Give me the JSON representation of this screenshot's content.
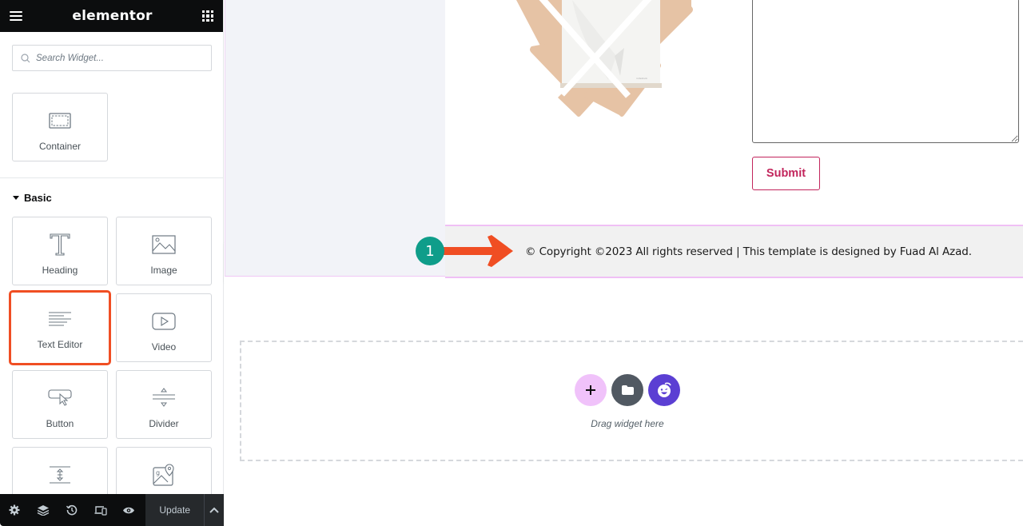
{
  "sidebar": {
    "brand": "elementor",
    "search": {
      "placeholder": "Search Widget...",
      "value": ""
    },
    "layout_widgets": [
      {
        "label": "Container",
        "icon": "container-icon"
      }
    ],
    "categories": [
      {
        "title": "Basic",
        "expanded": true,
        "widgets": [
          {
            "label": "Heading",
            "icon": "heading-icon",
            "highlighted": false
          },
          {
            "label": "Image",
            "icon": "image-icon",
            "highlighted": false
          },
          {
            "label": "Text Editor",
            "icon": "text-editor-icon",
            "highlighted": true
          },
          {
            "label": "Video",
            "icon": "video-icon",
            "highlighted": false
          },
          {
            "label": "Button",
            "icon": "button-icon",
            "highlighted": false
          },
          {
            "label": "Divider",
            "icon": "divider-icon",
            "highlighted": false
          },
          {
            "label": "",
            "icon": "spacer-icon",
            "highlighted": false
          },
          {
            "label": "",
            "icon": "google-maps-icon",
            "highlighted": false
          }
        ]
      }
    ],
    "bottom_bar": {
      "icons": [
        "settings-icon",
        "navigator-layers-icon",
        "history-icon",
        "responsive-mode-icon",
        "preview-eye-icon"
      ],
      "update_label": "Update"
    }
  },
  "canvas": {
    "form": {
      "submit_label": "Submit",
      "message_value": ""
    },
    "footer": {
      "text": "© Copyright ©2023 All rights reserved | This template is designed by Fuad Al Azad."
    },
    "annotation": {
      "number": "1",
      "color": "#0f9d8a",
      "arrow_color": "#f04e23"
    },
    "drop_zone": {
      "text": "Drag widget here",
      "buttons": [
        "add-section",
        "add-template",
        "ai-assistant"
      ]
    }
  },
  "colors": {
    "topbar": "#0c0d0e",
    "highlight": "#f04e23",
    "submit": "#c2255c",
    "add_button": "#f0c2fa",
    "template_button": "#515962",
    "ai_button": "#5b3fd3",
    "image_accent": "#e6c3a5"
  }
}
